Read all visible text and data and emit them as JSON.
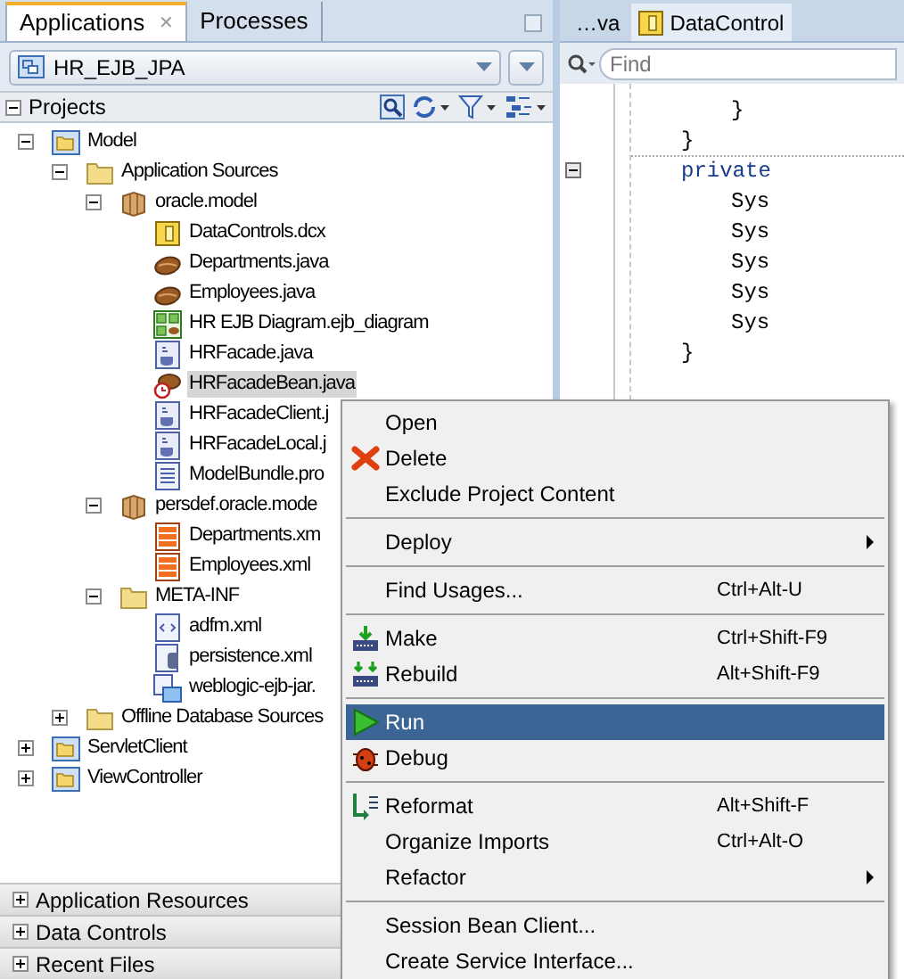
{
  "left_tabs": [
    {
      "label": "Applications",
      "selected": true,
      "close": "✕"
    },
    {
      "label": "Processes",
      "selected": false
    }
  ],
  "application": {
    "value": "HR_EJB_JPA"
  },
  "projects": {
    "title": "Projects",
    "expanded": true
  },
  "tree": [
    {
      "label": "Model",
      "kind": "project",
      "expanded": true,
      "selected": false,
      "children": [
        {
          "label": "Application Sources",
          "kind": "folder",
          "expanded": true,
          "selected": false,
          "children": [
            {
              "label": "oracle.model",
              "kind": "package",
              "expanded": true,
              "selected": false,
              "children": [
                {
                  "label": "DataControls.dcx",
                  "kind": "dcx",
                  "selected": false
                },
                {
                  "label": "Departments.java",
                  "kind": "bean",
                  "selected": false
                },
                {
                  "label": "Employees.java",
                  "kind": "bean",
                  "selected": false
                },
                {
                  "label": "HR EJB Diagram.ejb_diagram",
                  "kind": "diagram",
                  "selected": false
                },
                {
                  "label": "HRFacade.java",
                  "kind": "interface",
                  "selected": false
                },
                {
                  "label": "HRFacadeBean.java",
                  "kind": "session",
                  "selected": true
                },
                {
                  "label": "HRFacadeClient.j",
                  "kind": "interface",
                  "selected": false
                },
                {
                  "label": "HRFacadeLocal.j",
                  "kind": "interface",
                  "selected": false
                },
                {
                  "label": "ModelBundle.pro",
                  "kind": "properties",
                  "selected": false
                }
              ]
            },
            {
              "label": "persdef.oracle.mode",
              "kind": "package",
              "expanded": true,
              "selected": false,
              "children": [
                {
                  "label": "Departments.xm",
                  "kind": "mapping",
                  "selected": false
                },
                {
                  "label": "Employees.xml",
                  "kind": "mapping",
                  "selected": false
                }
              ]
            },
            {
              "label": "META-INF",
              "kind": "folder",
              "expanded": true,
              "selected": false,
              "children": [
                {
                  "label": "adfm.xml",
                  "kind": "xml",
                  "selected": false
                },
                {
                  "label": "persistence.xml",
                  "kind": "persistence",
                  "selected": false
                },
                {
                  "label": "weblogic-ejb-jar.",
                  "kind": "deployment",
                  "selected": false
                }
              ]
            }
          ]
        },
        {
          "label": "Offline Database Sources",
          "kind": "folder",
          "expanded": false,
          "selected": false
        }
      ]
    },
    {
      "label": "ServletClient",
      "kind": "project",
      "expanded": false,
      "selected": false
    },
    {
      "label": "ViewController",
      "kind": "project",
      "expanded": false,
      "selected": false
    }
  ],
  "accordions": [
    {
      "label": "Application Resources",
      "expanded": false
    },
    {
      "label": "Data Controls",
      "expanded": false
    },
    {
      "label": "Recent Files",
      "expanded": false
    }
  ],
  "editor_tabs": [
    {
      "label": "…va",
      "kind": "plain",
      "selected": false
    },
    {
      "label": "DataControl",
      "kind": "dcx",
      "selected": true
    }
  ],
  "find": {
    "placeholder": "Find"
  },
  "code": [
    {
      "text": "}",
      "kind": "brace-inner",
      "fold": false
    },
    {
      "text": "}",
      "kind": "brace",
      "fold": false
    },
    {
      "text": "private",
      "kind": "declaration",
      "fold": true
    },
    {
      "text": "Sys",
      "kind": "statement",
      "fold": false
    },
    {
      "text": "Sys",
      "kind": "statement",
      "fold": false
    },
    {
      "text": "Sys",
      "kind": "statement",
      "fold": false
    },
    {
      "text": "Sys",
      "kind": "statement",
      "fold": false
    },
    {
      "text": "Sys",
      "kind": "statement",
      "fold": false
    },
    {
      "text": "}",
      "kind": "brace",
      "fold": false
    }
  ],
  "context_menu": {
    "groups": [
      [
        {
          "label": "Open",
          "kind": "plain",
          "submenu": false,
          "selected": false
        },
        {
          "label": "Delete",
          "kind": "delete",
          "submenu": false,
          "selected": false
        },
        {
          "label": "Exclude Project Content",
          "kind": "plain",
          "submenu": false,
          "selected": false
        }
      ],
      [
        {
          "label": "Deploy",
          "kind": "plain",
          "submenu": true,
          "selected": false
        }
      ],
      [
        {
          "label": "Find Usages...",
          "shortcut": "Ctrl+Alt-U",
          "kind": "plain",
          "submenu": false,
          "selected": false
        }
      ],
      [
        {
          "label": "Make",
          "shortcut": "Ctrl+Shift-F9",
          "kind": "make",
          "submenu": false,
          "selected": false
        },
        {
          "label": "Rebuild",
          "shortcut": "Alt+Shift-F9",
          "kind": "rebuild",
          "submenu": false,
          "selected": false
        }
      ],
      [
        {
          "label": "Run",
          "kind": "run",
          "submenu": false,
          "selected": true
        },
        {
          "label": "Debug",
          "kind": "debug",
          "submenu": false,
          "selected": false
        }
      ],
      [
        {
          "label": "Reformat",
          "shortcut": "Alt+Shift-F",
          "kind": "reformat",
          "submenu": false,
          "selected": false
        },
        {
          "label": "Organize Imports",
          "shortcut": "Ctrl+Alt-O",
          "kind": "plain",
          "submenu": false,
          "selected": false
        },
        {
          "label": "Refactor",
          "kind": "plain",
          "submenu": true,
          "selected": false
        }
      ],
      [
        {
          "label": "Session Bean Client...",
          "kind": "plain",
          "submenu": false,
          "selected": false
        },
        {
          "label": "Create Service Interface...",
          "kind": "plain",
          "submenu": false,
          "selected": false
        }
      ]
    ]
  }
}
